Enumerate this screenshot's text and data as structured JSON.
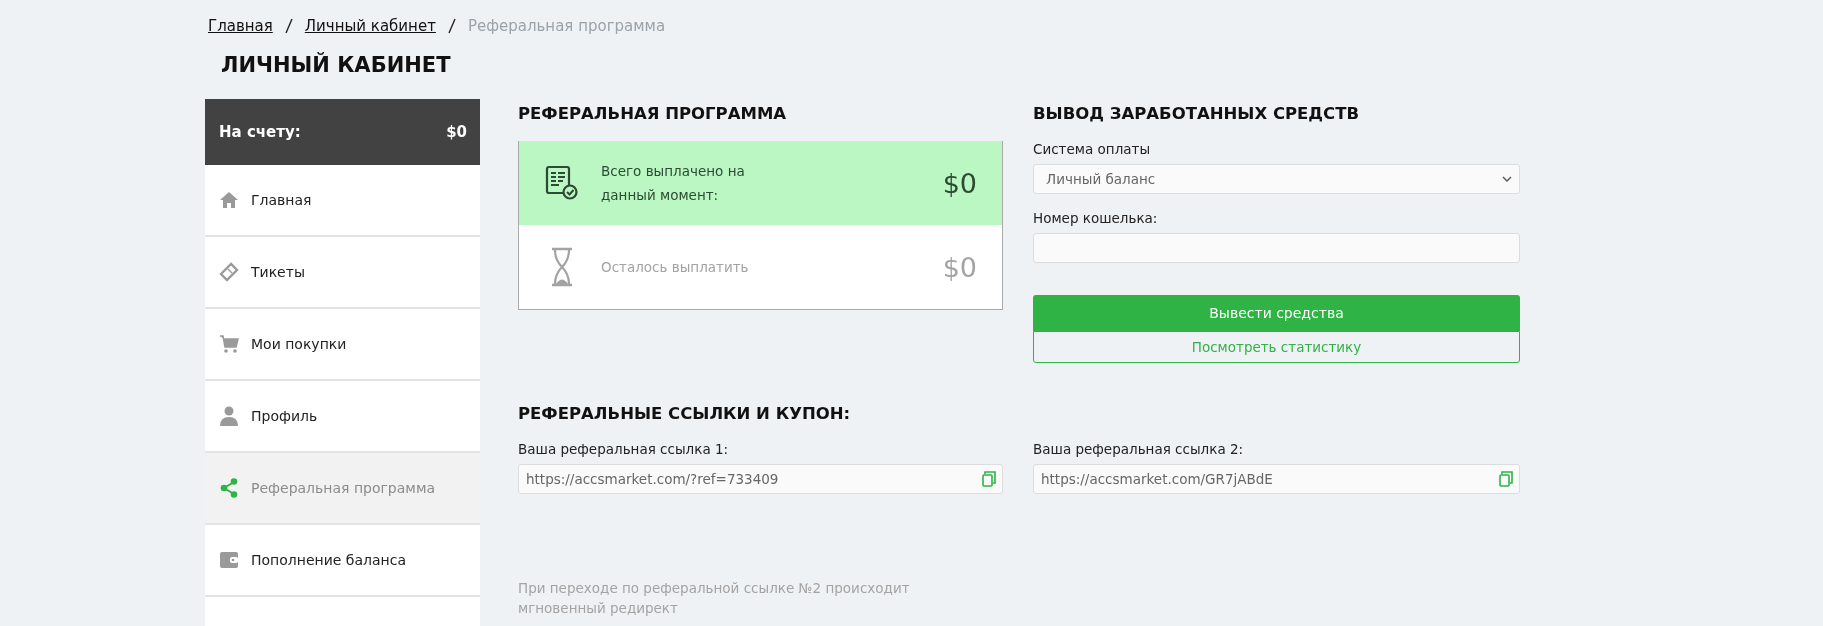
{
  "breadcrumbs": [
    {
      "label": "Главная",
      "kind": "link"
    },
    {
      "label": "Личный кабинет",
      "kind": "link"
    },
    {
      "label": "Реферальная программа",
      "kind": "current"
    }
  ],
  "page_title": "ЛИЧНЫЙ КАБИНЕТ",
  "sidebar": {
    "balance_label": "На счету:",
    "balance": "$0",
    "items": [
      {
        "label": "Главная",
        "kind": "home",
        "selected": false
      },
      {
        "label": "Тикеты",
        "kind": "ticket",
        "selected": false
      },
      {
        "label": "Мои покупки",
        "kind": "cart",
        "selected": false
      },
      {
        "label": "Профиль",
        "kind": "user",
        "selected": false
      },
      {
        "label": "Реферальная программа",
        "kind": "share",
        "selected": true
      },
      {
        "label": "Пополнение баланса",
        "kind": "wallet",
        "selected": false
      },
      {
        "kind": "other",
        "selected": false
      }
    ]
  },
  "referral": {
    "title": "РЕФЕРАЛЬНАЯ ПРОГРАММА",
    "stats": [
      {
        "kind": "paid",
        "label": "Всего выплачено на данный момент:",
        "amount": "$0"
      },
      {
        "kind": "pending",
        "label": "Осталось выплатить",
        "amount": "$0"
      }
    ]
  },
  "withdraw": {
    "title": "ВЫВОД ЗАРАБОТАННЫХ СРЕДСТВ",
    "system_label": "Система оплаты",
    "system_value": "Личный баланс",
    "wallet_label": "Номер кошелька:",
    "submit": "Вывести средства",
    "stats_button": "Посмотреть статистику"
  },
  "links": {
    "title": "РЕФЕРАЛЬНЫЕ ССЫЛКИ И КУПОН:",
    "items": [
      {
        "label": "Ваша реферальная ссылка 1:",
        "value": "https://accsmarket.com/?ref=733409"
      },
      {
        "label": "Ваша реферальная ссылка 2:",
        "value": "https://accsmarket.com/GR7jABdE"
      }
    ],
    "note": "При переходе по реферальной ссылке №2 происходит мгновенный редирект"
  }
}
